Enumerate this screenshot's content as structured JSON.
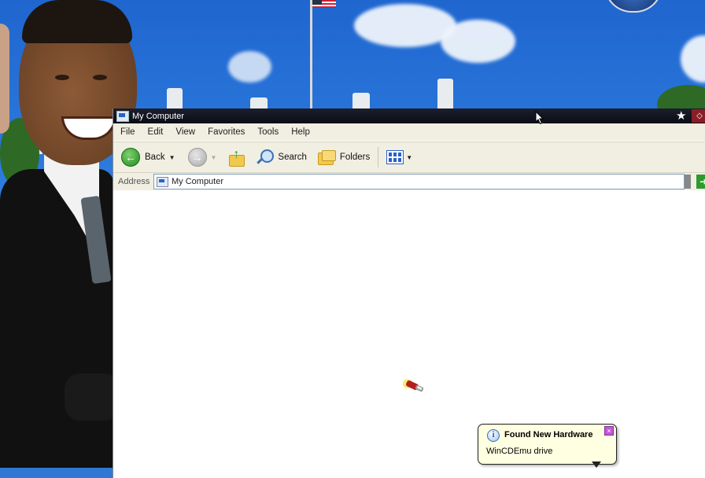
{
  "window": {
    "title": "My Computer",
    "title_icon": "my-computer-icon"
  },
  "menubar": {
    "items": [
      "File",
      "Edit",
      "View",
      "Favorites",
      "Tools",
      "Help"
    ]
  },
  "toolbar": {
    "back_label": "Back",
    "search_label": "Search",
    "folders_label": "Folders"
  },
  "addressbar": {
    "label": "Address",
    "value": "My Computer"
  },
  "notification": {
    "title": "Found New Hardware",
    "message": "WinCDEmu drive",
    "icon": "info-icon"
  },
  "colors": {
    "titlebar": "#0a0c16",
    "chrome": "#f1efe2",
    "balloon": "#ffffe1",
    "desktop_sky": "#2f7fe0"
  }
}
